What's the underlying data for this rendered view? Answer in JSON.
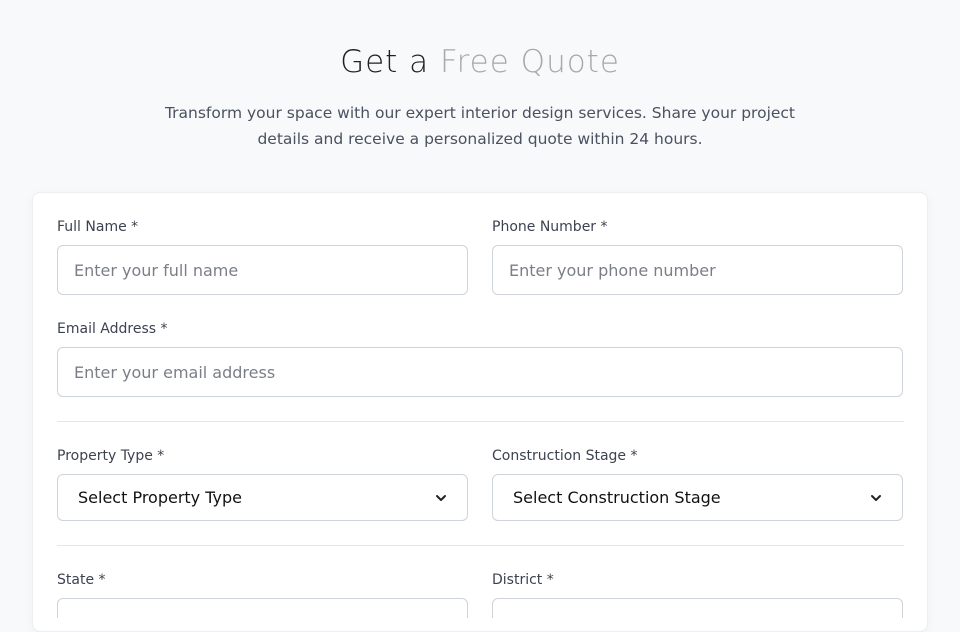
{
  "header": {
    "title_lead": "Get a",
    "title_accent": "Free Quote",
    "subtitle": "Transform your space with our expert interior design services. Share your project details and receive a personalized quote within 24 hours."
  },
  "form": {
    "full_name": {
      "label": "Full Name *",
      "placeholder": "Enter your full name"
    },
    "phone": {
      "label": "Phone Number *",
      "placeholder": "Enter your phone number"
    },
    "email": {
      "label": "Email Address *",
      "placeholder": "Enter your email address"
    },
    "property_type": {
      "label": "Property Type *",
      "selected": "Select Property Type"
    },
    "construction_stage": {
      "label": "Construction Stage *",
      "selected": "Select Construction Stage"
    },
    "state": {
      "label": "State *"
    },
    "district": {
      "label": "District *"
    }
  }
}
